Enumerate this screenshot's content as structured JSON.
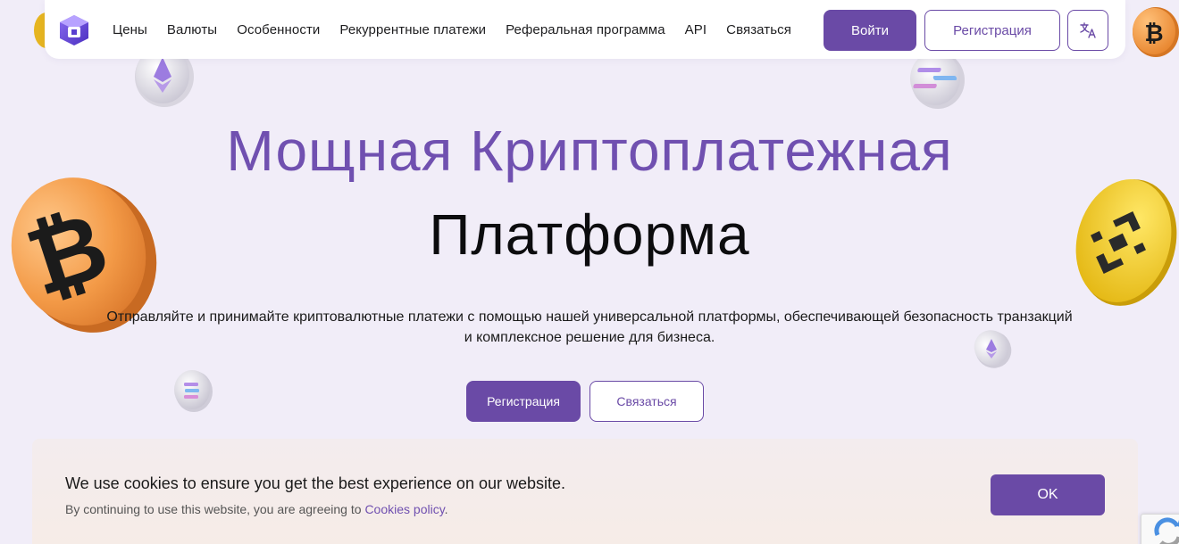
{
  "header": {
    "nav": [
      {
        "label": "Цены"
      },
      {
        "label": "Валюты"
      },
      {
        "label": "Особенности"
      },
      {
        "label": "Рекуррентные платежи"
      },
      {
        "label": "Реферальная программа"
      },
      {
        "label": "API"
      },
      {
        "label": "Связаться"
      }
    ],
    "login_label": "Войти",
    "register_label": "Регистрация",
    "lang_icon": "translate-icon"
  },
  "hero": {
    "title_line1": "Мощная Криптоплатежная",
    "title_line2": "Платформа",
    "subtitle_line1": "Отправляйте и принимайте криптовалютные платежи с помощью нашей универсальной платформы, обеспечивающей безопасность транзакций",
    "subtitle_line2": "и комплексное решение для бизнеса.",
    "register_label": "Регистрация",
    "contact_label": "Связаться"
  },
  "cookie": {
    "title": "We use cookies to ensure you get the best experience on our website.",
    "text_prefix": "By continuing to use this website, you are agreeing to ",
    "link_label": "Cookies policy",
    "text_suffix": ".",
    "ok_label": "OK"
  },
  "colors": {
    "accent": "#6a4aa6",
    "title_purple": "#7050b0",
    "background": "#f1edf8"
  }
}
